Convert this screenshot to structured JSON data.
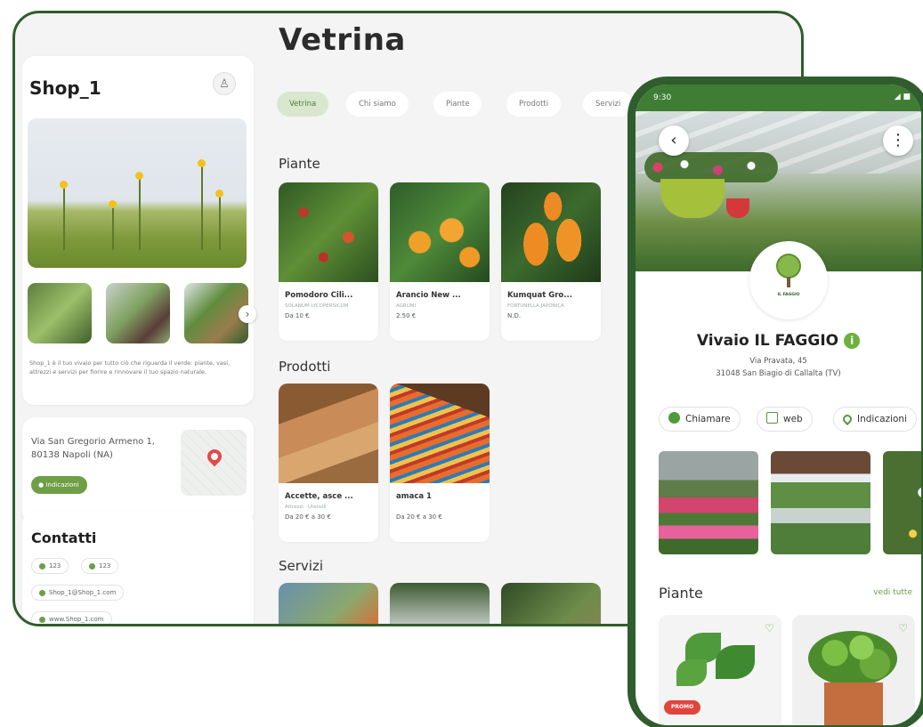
{
  "tablet": {
    "shop": {
      "name": "Shop_1",
      "description": "Shop_1 è il tuo vivaio per tutto ciò che riguarda il verde: piante, vasi, attrezzi e servizi per fiorire e rinnovare il tuo spazio naturale.",
      "address": "Via San Gregorio Armeno 1, 80138 Napoli (NA)",
      "directions_label": "Indicazioni"
    },
    "contacts": {
      "title": "Contatti",
      "phone_1": "123",
      "phone_2": "123",
      "email": "Shop_1@Shop_1.com",
      "website": "www.Shop_1.com"
    },
    "page_title": "Vetrina",
    "tabs": [
      "Vetrina",
      "Chi siamo",
      "Piante",
      "Prodotti",
      "Servizi"
    ],
    "sections": {
      "plants": "Piante",
      "products": "Prodotti",
      "services": "Servizi"
    },
    "plants": [
      {
        "name": "Pomodoro Cili...",
        "sub": "SOLANUM LYCOPERSICUM",
        "price": "Da 10 €"
      },
      {
        "name": "Arancio New ...",
        "sub": "AGRUMI",
        "price": "2.50 €"
      },
      {
        "name": "Kumquat Gro...",
        "sub": "FORTUNELLA JAPONICA",
        "price": "N.D."
      }
    ],
    "products": [
      {
        "name": "Accette, asce ...",
        "sub": "Attrezzi · Utensili",
        "price": "Da 20 € a 30 €"
      },
      {
        "name": "amaca 1",
        "sub": "",
        "price": "Da 20 € a 30 €"
      }
    ]
  },
  "phone": {
    "time": "9:30",
    "status_icons": "◢ ■",
    "business_name": "Vivaio IL FAGGIO",
    "logo_text": "IL FAGGIO",
    "address_line1": "Via Pravata, 45",
    "address_line2": "31048 San Biagio di Callalta (TV)",
    "actions": {
      "call": "Chiamare",
      "web": "web",
      "directions": "Indicazioni"
    },
    "section_title": "Piante",
    "see_all": "vedi tutte",
    "promo_label": "PROMO"
  },
  "colors": {
    "frame_green": "#2f5d2d",
    "accent_green": "#6e9e46",
    "tab_active_bg": "#d9e7cf",
    "promo_red": "#e0453d"
  }
}
